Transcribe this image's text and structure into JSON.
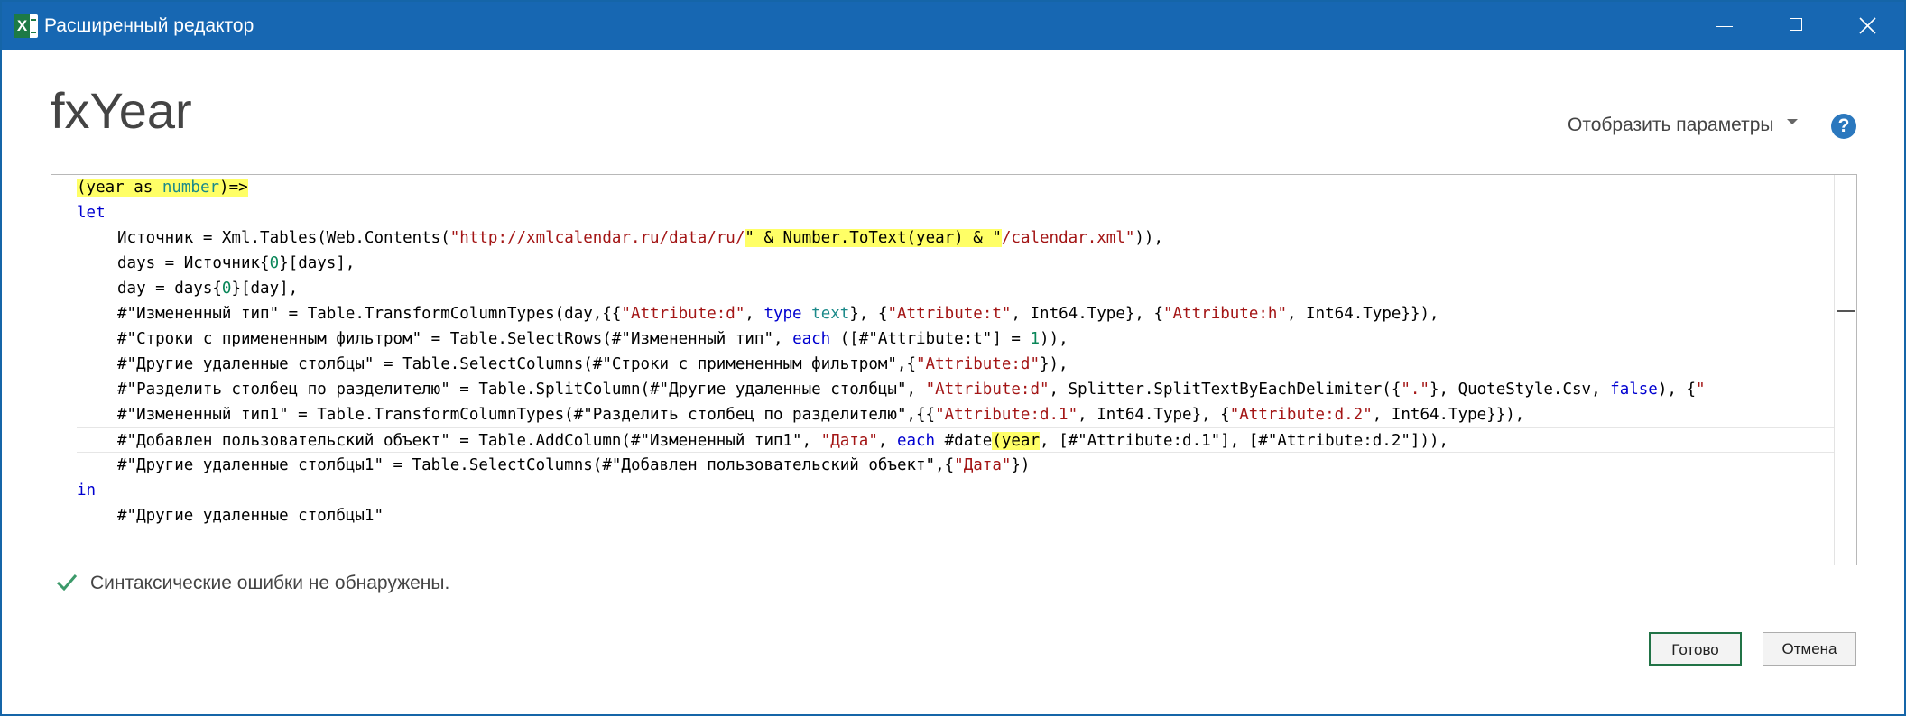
{
  "window": {
    "app_icon_letter": "X",
    "title": "Расширенный редактор"
  },
  "query_name": "fxYear",
  "display_options_label": "Отобразить параметры",
  "help_label": "?",
  "code": {
    "l1": {
      "open_paren": "(year as ",
      "type": "number",
      "close": ")=>"
    },
    "l2": {
      "kw": "let"
    },
    "l3": {
      "a": "Источник = Xml.Tables(Web.Contents(",
      "s1": "\"http://xmlcalendar.ru/data/ru/",
      "h1": "\" & Number.ToText(year) & \"",
      "s2": "/calendar.xml\"",
      "b": ")),"
    },
    "l4": {
      "a": "days = Источник{",
      "n": "0",
      "b": "}[days],"
    },
    "l5": {
      "a": "day = days{",
      "n": "0",
      "b": "}[day],"
    },
    "l6": {
      "a": "#\"Измененный тип\" = Table.TransformColumnTypes(day,{{",
      "s1": "\"Attribute:d\"",
      "b": ", ",
      "kw": "type",
      "c": " ",
      "ty": "text",
      "d": "}, {",
      "s2": "\"Attribute:t\"",
      "e": ", Int64.Type}, {",
      "s3": "\"Attribute:h\"",
      "f": ", Int64.Type}}),"
    },
    "l7": {
      "a": "#\"Строки с примененным фильтром\" = Table.SelectRows(#\"Измененный тип\", ",
      "kw": "each",
      "b": " ([#\"Attribute:t\"] = ",
      "n": "1",
      "c": ")),"
    },
    "l8": {
      "a": "#\"Другие удаленные столбцы\" = Table.SelectColumns(#\"Строки с примененным фильтром\",{",
      "s": "\"Attribute:d\"",
      "b": "}),"
    },
    "l9": {
      "a": "#\"Разделить столбец по разделителю\" = Table.SplitColumn(#\"Другие удаленные столбцы\", ",
      "s1": "\"Attribute:d\"",
      "b": ", Splitter.SplitTextByEachDelimiter({",
      "s2": "\".\"",
      "c": "}, QuoteStyle.Csv, ",
      "kw": "false",
      "d": "), {",
      "s3": "\""
    },
    "l10": {
      "a": "#\"Измененный тип1\" = Table.TransformColumnTypes(#\"Разделить столбец по разделителю\",{{",
      "s1": "\"Attribute:d.1\"",
      "b": ", Int64.Type}, {",
      "s2": "\"Attribute:d.2\"",
      "c": ", Int64.Type}}),"
    },
    "l11": {
      "a": "#\"Добавлен пользовательский объект\" = Table.AddColumn(#\"Измененный тип1\", ",
      "s": "\"Дата\"",
      "b": ", ",
      "kw": "each",
      "c": " #date",
      "h": "(year",
      "d": ", [#\"Attribute:d.1\"], [#\"Attribute:d.2\"])),"
    },
    "l12": {
      "a": "#\"Другие удаленные столбцы1\" = Table.SelectColumns(#\"Добавлен пользовательский объект\",{",
      "s": "\"Дата\"",
      "b": "})"
    },
    "l13": {
      "kw": "in"
    },
    "l14": {
      "a": "#\"Другие удаленные столбцы1\""
    }
  },
  "status_text": "Синтаксические ошибки не обнаружены.",
  "buttons": {
    "ok": "Готово",
    "cancel": "Отмена"
  },
  "colors": {
    "titlebar": "#1767b2",
    "keyword": "#0000d0",
    "type": "#1b8a8a",
    "string": "#a31515",
    "number": "#098658",
    "highlight": "#ffff66",
    "ok_border": "#217346",
    "check": "#3c9a6a"
  }
}
